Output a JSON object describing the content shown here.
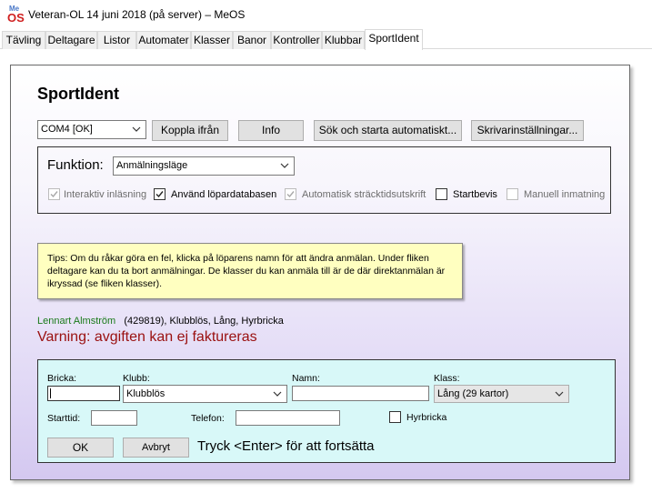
{
  "window": {
    "title": "Veteran-OL 14 juni 2018 (på server) – MeOS",
    "icon_top": "Me",
    "icon_bottom": "OS"
  },
  "tabs": [
    {
      "label": "Tävling"
    },
    {
      "label": "Deltagare"
    },
    {
      "label": "Listor"
    },
    {
      "label": "Automater"
    },
    {
      "label": "Klasser"
    },
    {
      "label": "Banor"
    },
    {
      "label": "Kontroller"
    },
    {
      "label": "Klubbar"
    },
    {
      "label": "SportIdent",
      "active": true
    }
  ],
  "page": {
    "heading": "SportIdent",
    "port_select": "COM4 [OK]",
    "buttons": {
      "disconnect": "Koppla ifrån",
      "info": "Info",
      "search_start": "Sök och starta automatiskt...",
      "printer_settings": "Skrivarinställningar..."
    },
    "function": {
      "label": "Funktion:",
      "mode_select": "Anmälningsläge"
    },
    "options": [
      {
        "label": "Interaktiv inläsning",
        "checked": true,
        "enabled": false
      },
      {
        "label": "Använd löpardatabasen",
        "checked": true,
        "enabled": true
      },
      {
        "label": "Automatisk sträcktidsutskrift",
        "checked": true,
        "enabled": false
      },
      {
        "label": "Startbevis",
        "checked": false,
        "enabled": true
      },
      {
        "label": "Manuell inmatning",
        "checked": false,
        "enabled": false
      }
    ],
    "tips": "Tips: Om du råkar göra en fel, klicka på löparens namn för att ändra anmälan. Under fliken deltagare kan du ta bort anmälningar. De klasser du kan anmäla till är de där direktanmälan är ikryssad (se fliken klasser).",
    "runner": {
      "name": "Lennart Almström",
      "details": "(429819), Klubblös, Lång, Hyrbricka"
    },
    "warning": "Varning: avgiften kan ej faktureras",
    "entry": {
      "card_label": "Bricka:",
      "card_value": "",
      "club_label": "Klubb:",
      "club_value": "Klubblös",
      "name_label": "Namn:",
      "name_value": "",
      "class_label": "Klass:",
      "class_value": "Lång (29 kartor)",
      "start_label": "Starttid:",
      "start_value": "",
      "phone_label": "Telefon:",
      "phone_value": "",
      "rental_label": "Hyrbricka",
      "rental_checked": false,
      "ok_button": "OK",
      "cancel_button": "Avbryt",
      "hint": "Tryck <Enter> för att fortsätta"
    }
  },
  "colors": {
    "runner_name": "#1a7a1a",
    "warning": "#9a1010",
    "tips_background": "#ffffc0",
    "entry_background": "#d8f8f8"
  }
}
